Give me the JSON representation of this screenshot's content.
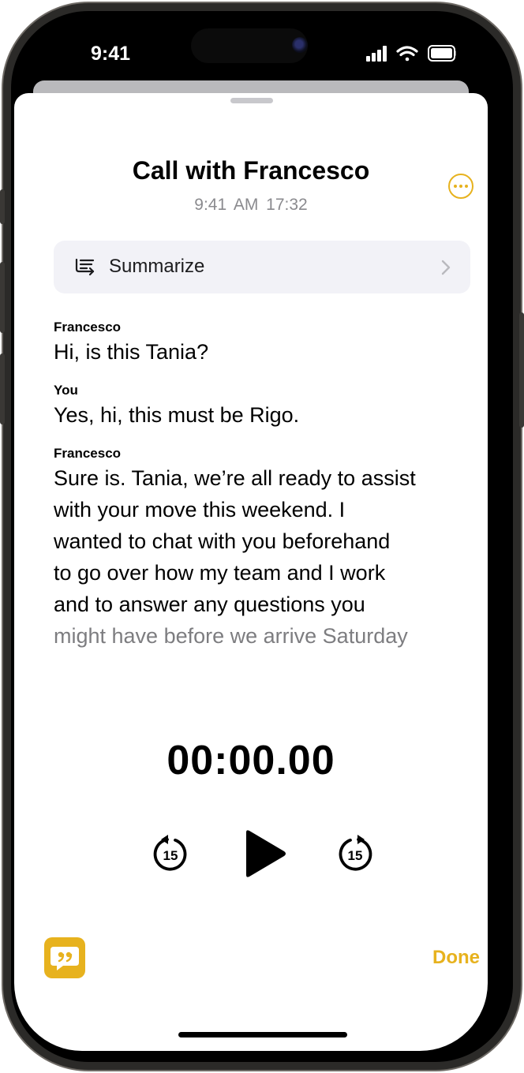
{
  "status_bar": {
    "time": "9:41"
  },
  "header": {
    "title": "Call with Francesco",
    "time": "9:41 AM",
    "duration": "17:32"
  },
  "summarize": {
    "label": "Summarize"
  },
  "transcript": [
    {
      "speaker": "Francesco",
      "text": "Hi, is this Tania?"
    },
    {
      "speaker": "You",
      "text": "Yes, hi, this must be Rigo."
    },
    {
      "speaker": "Francesco",
      "lines": [
        "Sure is. Tania, we’re all ready to assist",
        "with your move this weekend. I",
        "wanted to chat with you beforehand",
        "to go over how my team and I work",
        "and to answer any questions you",
        "might have before we arrive Saturday"
      ]
    }
  ],
  "player": {
    "timer": "00:00.00",
    "skip_back_seconds": "15",
    "skip_forward_seconds": "15"
  },
  "footer": {
    "done_label": "Done"
  },
  "colors": {
    "accent": "#e7b21e"
  },
  "icons": {
    "more": "ellipsis-circle-icon",
    "summarize": "summarize-list-icon",
    "chevron": "chevron-right-icon",
    "skip_back": "gobackward-15-icon",
    "play": "play-icon",
    "skip_forward": "goforward-15-icon",
    "quote": "quote-bubble-icon"
  }
}
